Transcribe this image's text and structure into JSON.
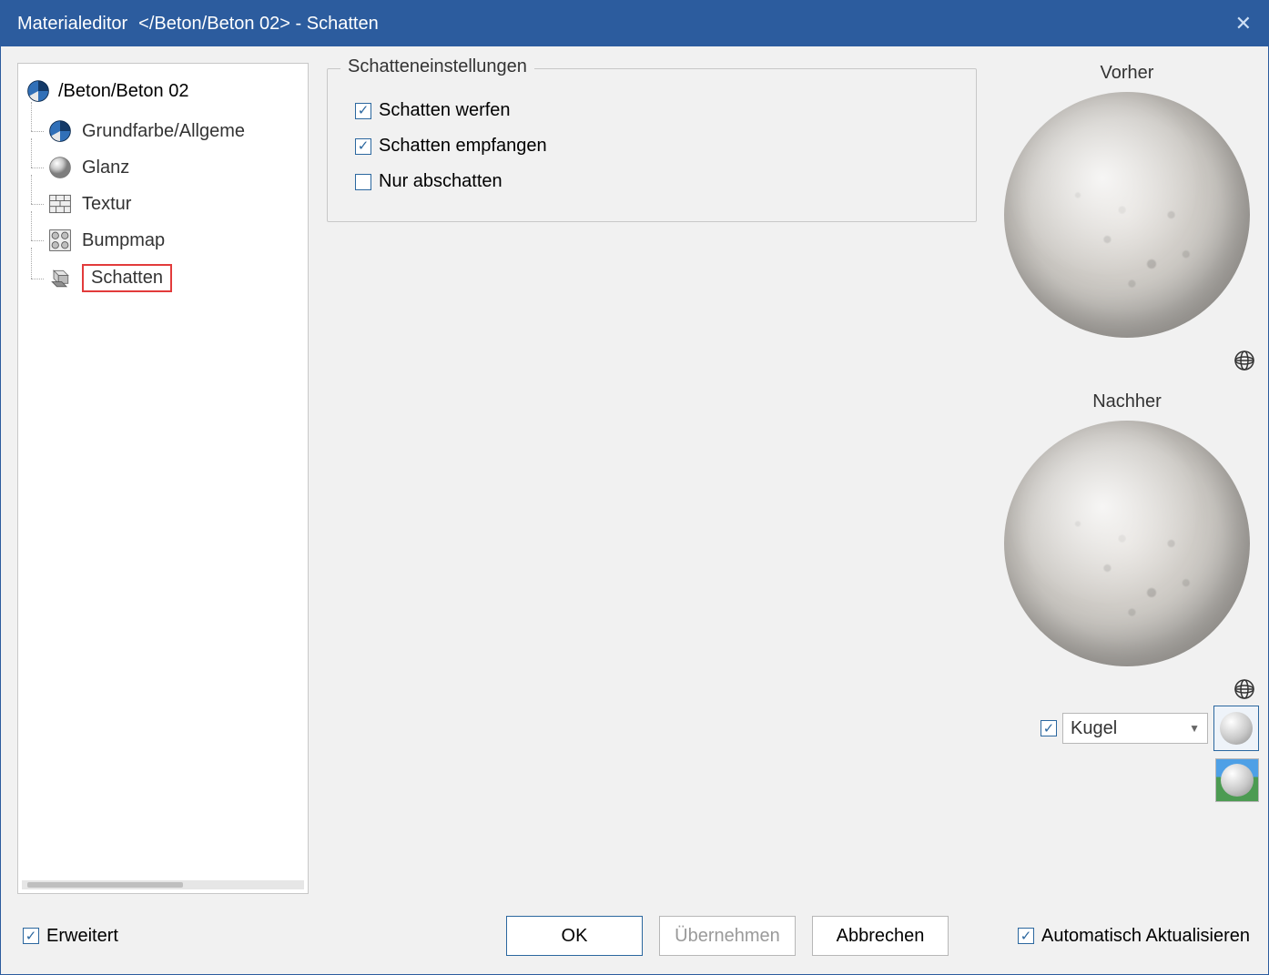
{
  "titlebar": {
    "app": "Materialeditor",
    "path": "</Beton/Beton 02> - Schatten"
  },
  "tree": {
    "root": "/Beton/Beton 02",
    "items": [
      {
        "label": "Grundfarbe/Allgeme",
        "icon": "pie-icon"
      },
      {
        "label": "Glanz",
        "icon": "ball-icon"
      },
      {
        "label": "Textur",
        "icon": "brick-icon"
      },
      {
        "label": "Bumpmap",
        "icon": "bump-icon"
      },
      {
        "label": "Schatten",
        "icon": "cubes-icon",
        "selected": true
      }
    ]
  },
  "settings": {
    "group_title": "Schatteneinstellungen",
    "cast": {
      "label": "Schatten werfen",
      "checked": true
    },
    "receive": {
      "label": "Schatten empfangen",
      "checked": true
    },
    "only": {
      "label": "Nur abschatten",
      "checked": false
    }
  },
  "preview": {
    "before_label": "Vorher",
    "after_label": "Nachher",
    "shape_checkbox_checked": true,
    "shape_select_value": "Kugel"
  },
  "bottom": {
    "erweitert": {
      "label": "Erweitert",
      "checked": true
    },
    "ok": "OK",
    "apply": "Übernehmen",
    "cancel": "Abbrechen",
    "auto": {
      "label": "Automatisch Aktualisieren",
      "checked": true
    }
  }
}
